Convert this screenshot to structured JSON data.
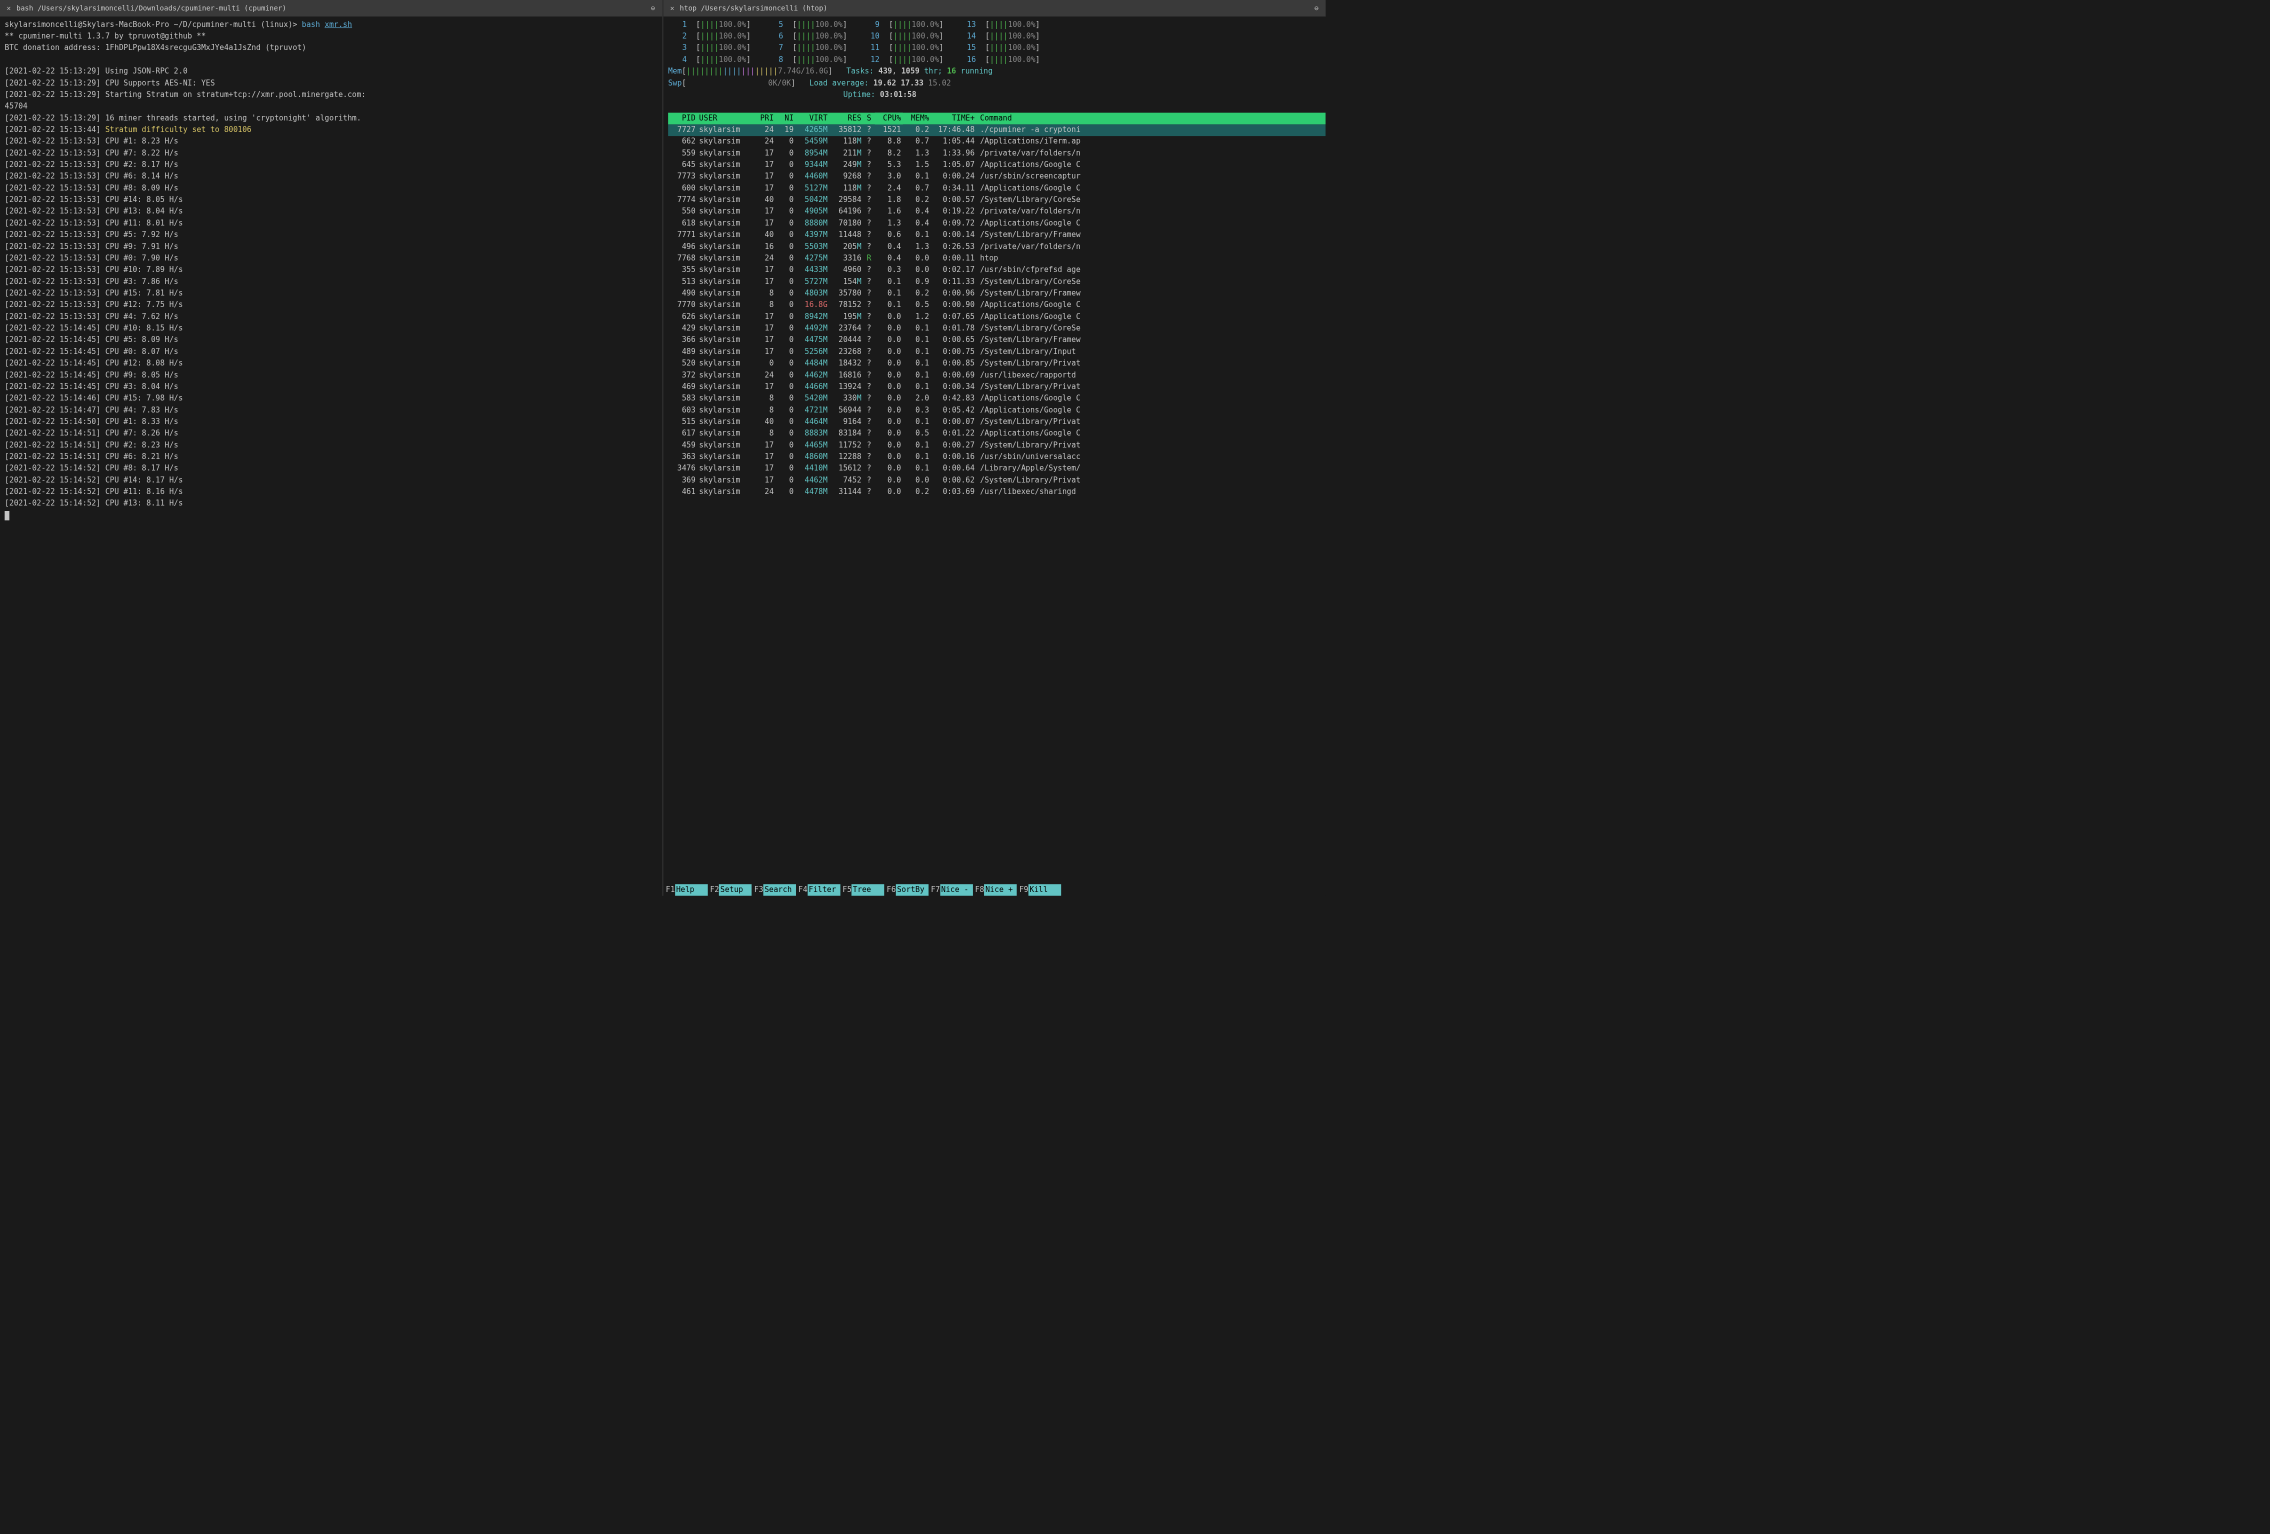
{
  "tabs": {
    "left": "bash /Users/skylarsimoncelli/Downloads/cpuminer-multi (cpuminer)",
    "right": "htop /Users/skylarsimoncelli (htop)"
  },
  "prompt": {
    "userhost": "skylarsimoncelli@Skylars-MacBook-Pro",
    "path": "~/D/cpuminer-multi",
    "os": "(linux)",
    "arrow": ">",
    "cmd": "bash",
    "arg": "xmr.sh"
  },
  "banner": [
    "** cpuminer-multi 1.3.7 by tpruvot@github **",
    "BTC donation address: 1FhDPLPpw18X4srecguG3MxJYe4a1JsZnd (tpruvot)"
  ],
  "log": [
    {
      "t": "[2021-02-22 15:13:29]",
      "m": "Using JSON-RPC 2.0"
    },
    {
      "t": "[2021-02-22 15:13:29]",
      "m": "CPU Supports AES-NI: YES"
    },
    {
      "t": "[2021-02-22 15:13:29]",
      "m": "Starting Stratum on stratum+tcp://xmr.pool.minergate.com:"
    },
    {
      "t": "",
      "m": "45704"
    },
    {
      "t": "[2021-02-22 15:13:29]",
      "m": "16 miner threads started, using 'cryptonight' algorithm."
    },
    {
      "t": "[2021-02-22 15:13:44]",
      "m": "Stratum difficulty set to 800106",
      "y": true
    },
    {
      "t": "[2021-02-22 15:13:53]",
      "m": "CPU #1: 8.23 H/s"
    },
    {
      "t": "[2021-02-22 15:13:53]",
      "m": "CPU #7: 8.22 H/s"
    },
    {
      "t": "[2021-02-22 15:13:53]",
      "m": "CPU #2: 8.17 H/s"
    },
    {
      "t": "[2021-02-22 15:13:53]",
      "m": "CPU #6: 8.14 H/s"
    },
    {
      "t": "[2021-02-22 15:13:53]",
      "m": "CPU #8: 8.09 H/s"
    },
    {
      "t": "[2021-02-22 15:13:53]",
      "m": "CPU #14: 8.05 H/s"
    },
    {
      "t": "[2021-02-22 15:13:53]",
      "m": "CPU #13: 8.04 H/s"
    },
    {
      "t": "[2021-02-22 15:13:53]",
      "m": "CPU #11: 8.01 H/s"
    },
    {
      "t": "[2021-02-22 15:13:53]",
      "m": "CPU #5: 7.92 H/s"
    },
    {
      "t": "[2021-02-22 15:13:53]",
      "m": "CPU #9: 7.91 H/s"
    },
    {
      "t": "[2021-02-22 15:13:53]",
      "m": "CPU #0: 7.90 H/s"
    },
    {
      "t": "[2021-02-22 15:13:53]",
      "m": "CPU #10: 7.89 H/s"
    },
    {
      "t": "[2021-02-22 15:13:53]",
      "m": "CPU #3: 7.86 H/s"
    },
    {
      "t": "[2021-02-22 15:13:53]",
      "m": "CPU #15: 7.81 H/s"
    },
    {
      "t": "[2021-02-22 15:13:53]",
      "m": "CPU #12: 7.75 H/s"
    },
    {
      "t": "[2021-02-22 15:13:53]",
      "m": "CPU #4: 7.62 H/s"
    },
    {
      "t": "[2021-02-22 15:14:45]",
      "m": "CPU #10: 8.15 H/s"
    },
    {
      "t": "[2021-02-22 15:14:45]",
      "m": "CPU #5: 8.09 H/s"
    },
    {
      "t": "[2021-02-22 15:14:45]",
      "m": "CPU #0: 8.07 H/s"
    },
    {
      "t": "[2021-02-22 15:14:45]",
      "m": "CPU #12: 8.08 H/s"
    },
    {
      "t": "[2021-02-22 15:14:45]",
      "m": "CPU #9: 8.05 H/s"
    },
    {
      "t": "[2021-02-22 15:14:45]",
      "m": "CPU #3: 8.04 H/s"
    },
    {
      "t": "[2021-02-22 15:14:46]",
      "m": "CPU #15: 7.98 H/s"
    },
    {
      "t": "[2021-02-22 15:14:47]",
      "m": "CPU #4: 7.83 H/s"
    },
    {
      "t": "[2021-02-22 15:14:50]",
      "m": "CPU #1: 8.33 H/s"
    },
    {
      "t": "[2021-02-22 15:14:51]",
      "m": "CPU #7: 8.26 H/s"
    },
    {
      "t": "[2021-02-22 15:14:51]",
      "m": "CPU #2: 8.23 H/s"
    },
    {
      "t": "[2021-02-22 15:14:51]",
      "m": "CPU #6: 8.21 H/s"
    },
    {
      "t": "[2021-02-22 15:14:52]",
      "m": "CPU #8: 8.17 H/s"
    },
    {
      "t": "[2021-02-22 15:14:52]",
      "m": "CPU #14: 8.17 H/s"
    },
    {
      "t": "[2021-02-22 15:14:52]",
      "m": "CPU #11: 8.16 H/s"
    },
    {
      "t": "[2021-02-22 15:14:52]",
      "m": "CPU #13: 8.11 H/s"
    }
  ],
  "htop": {
    "cpus": [
      {
        "n": "1",
        "p": "100.0%"
      },
      {
        "n": "2",
        "p": "100.0%"
      },
      {
        "n": "3",
        "p": "100.0%"
      },
      {
        "n": "4",
        "p": "100.0%"
      },
      {
        "n": "5",
        "p": "100.0%"
      },
      {
        "n": "6",
        "p": "100.0%"
      },
      {
        "n": "7",
        "p": "100.0%"
      },
      {
        "n": "8",
        "p": "100.0%"
      },
      {
        "n": "9",
        "p": "100.0%"
      },
      {
        "n": "10",
        "p": "100.0%"
      },
      {
        "n": "11",
        "p": "100.0%"
      },
      {
        "n": "12",
        "p": "100.0%"
      },
      {
        "n": "13",
        "p": "100.0%"
      },
      {
        "n": "14",
        "p": "100.0%"
      },
      {
        "n": "15",
        "p": "100.0%"
      },
      {
        "n": "16",
        "p": "100.0%"
      }
    ],
    "mem": {
      "label": "Mem",
      "bar": "||||||||||||||||||||",
      "used": "7.74G",
      "total": "16.0G"
    },
    "swp": {
      "label": "Swp",
      "used": "0K",
      "total": "0K"
    },
    "tasks": {
      "label": "Tasks:",
      "count": "439",
      "thr": "1059",
      "thr_lab": "thr;",
      "run": "16",
      "run_lab": "running"
    },
    "load": {
      "label": "Load average:",
      "v1": "19.62",
      "v2": "17.33",
      "v3": "15.02"
    },
    "uptime": {
      "label": "Uptime:",
      "val": "03:01:58"
    },
    "cols": {
      "pid": "PID",
      "user": "USER",
      "pri": "PRI",
      "ni": "NI",
      "virt": "VIRT",
      "res": "RES",
      "s": "S",
      "cpu": "CPU%",
      "mem": "MEM%",
      "time": "TIME+",
      "cmd": "Command"
    },
    "rows": [
      {
        "pid": "7727",
        "user": "skylarsim",
        "pri": "24",
        "ni": "19",
        "virt": "4265M",
        "res": "35812",
        "s": "?",
        "cpu": "1521",
        "mem": "0.2",
        "time": "17:46.48",
        "cmd": "./cpuminer -a cryptoni",
        "sel": true
      },
      {
        "pid": "662",
        "user": "skylarsim",
        "pri": "24",
        "ni": "0",
        "virt": "5459M",
        "res": "118M",
        "s": "?",
        "cpu": "8.8",
        "mem": "0.7",
        "time": "1:05.44",
        "cmd": "/Applications/iTerm.ap"
      },
      {
        "pid": "559",
        "user": "skylarsim",
        "pri": "17",
        "ni": "0",
        "virt": "8954M",
        "res": "211M",
        "s": "?",
        "cpu": "8.2",
        "mem": "1.3",
        "time": "1:33.96",
        "cmd": "/private/var/folders/n"
      },
      {
        "pid": "645",
        "user": "skylarsim",
        "pri": "17",
        "ni": "0",
        "virt": "9344M",
        "res": "249M",
        "s": "?",
        "cpu": "5.3",
        "mem": "1.5",
        "time": "1:05.07",
        "cmd": "/Applications/Google C"
      },
      {
        "pid": "7773",
        "user": "skylarsim",
        "pri": "17",
        "ni": "0",
        "virt": "4460M",
        "res": "9268",
        "s": "?",
        "cpu": "3.0",
        "mem": "0.1",
        "time": "0:00.24",
        "cmd": "/usr/sbin/screencaptur"
      },
      {
        "pid": "600",
        "user": "skylarsim",
        "pri": "17",
        "ni": "0",
        "virt": "5127M",
        "res": "118M",
        "s": "?",
        "cpu": "2.4",
        "mem": "0.7",
        "time": "0:34.11",
        "cmd": "/Applications/Google C"
      },
      {
        "pid": "7774",
        "user": "skylarsim",
        "pri": "40",
        "ni": "0",
        "virt": "5042M",
        "res": "29584",
        "s": "?",
        "cpu": "1.8",
        "mem": "0.2",
        "time": "0:00.57",
        "cmd": "/System/Library/CoreSe"
      },
      {
        "pid": "550",
        "user": "skylarsim",
        "pri": "17",
        "ni": "0",
        "virt": "4905M",
        "res": "64196",
        "s": "?",
        "cpu": "1.6",
        "mem": "0.4",
        "time": "0:19.22",
        "cmd": "/private/var/folders/n"
      },
      {
        "pid": "618",
        "user": "skylarsim",
        "pri": "17",
        "ni": "0",
        "virt": "8880M",
        "res": "70180",
        "s": "?",
        "cpu": "1.3",
        "mem": "0.4",
        "time": "0:09.72",
        "cmd": "/Applications/Google C"
      },
      {
        "pid": "7771",
        "user": "skylarsim",
        "pri": "40",
        "ni": "0",
        "virt": "4397M",
        "res": "11448",
        "s": "?",
        "cpu": "0.6",
        "mem": "0.1",
        "time": "0:00.14",
        "cmd": "/System/Library/Framew"
      },
      {
        "pid": "496",
        "user": "skylarsim",
        "pri": "16",
        "ni": "0",
        "virt": "5503M",
        "res": "205M",
        "s": "?",
        "cpu": "0.4",
        "mem": "1.3",
        "time": "0:26.53",
        "cmd": "/private/var/folders/n"
      },
      {
        "pid": "7768",
        "user": "skylarsim",
        "pri": "24",
        "ni": "0",
        "virt": "4275M",
        "res": "3316",
        "s": "R",
        "cpu": "0.4",
        "mem": "0.0",
        "time": "0:00.11",
        "cmd": "htop",
        "sR": true
      },
      {
        "pid": "355",
        "user": "skylarsim",
        "pri": "17",
        "ni": "0",
        "virt": "4433M",
        "res": "4960",
        "s": "?",
        "cpu": "0.3",
        "mem": "0.0",
        "time": "0:02.17",
        "cmd": "/usr/sbin/cfprefsd age"
      },
      {
        "pid": "513",
        "user": "skylarsim",
        "pri": "17",
        "ni": "0",
        "virt": "5727M",
        "res": "154M",
        "s": "?",
        "cpu": "0.1",
        "mem": "0.9",
        "time": "0:11.33",
        "cmd": "/System/Library/CoreSe"
      },
      {
        "pid": "490",
        "user": "skylarsim",
        "pri": "8",
        "ni": "0",
        "virt": "4803M",
        "res": "35780",
        "s": "?",
        "cpu": "0.1",
        "mem": "0.2",
        "time": "0:00.96",
        "cmd": "/System/Library/Framew"
      },
      {
        "pid": "7770",
        "user": "skylarsim",
        "pri": "8",
        "ni": "0",
        "virt": "16.8G",
        "res": "78152",
        "s": "?",
        "cpu": "0.1",
        "mem": "0.5",
        "time": "0:00.90",
        "cmd": "/Applications/Google C",
        "vR": true
      },
      {
        "pid": "626",
        "user": "skylarsim",
        "pri": "17",
        "ni": "0",
        "virt": "8942M",
        "res": "195M",
        "s": "?",
        "cpu": "0.0",
        "mem": "1.2",
        "time": "0:07.65",
        "cmd": "/Applications/Google C"
      },
      {
        "pid": "429",
        "user": "skylarsim",
        "pri": "17",
        "ni": "0",
        "virt": "4492M",
        "res": "23764",
        "s": "?",
        "cpu": "0.0",
        "mem": "0.1",
        "time": "0:01.78",
        "cmd": "/System/Library/CoreSe"
      },
      {
        "pid": "366",
        "user": "skylarsim",
        "pri": "17",
        "ni": "0",
        "virt": "4475M",
        "res": "20444",
        "s": "?",
        "cpu": "0.0",
        "mem": "0.1",
        "time": "0:00.65",
        "cmd": "/System/Library/Framew"
      },
      {
        "pid": "489",
        "user": "skylarsim",
        "pri": "17",
        "ni": "0",
        "virt": "5256M",
        "res": "23268",
        "s": "?",
        "cpu": "0.0",
        "mem": "0.1",
        "time": "0:00.75",
        "cmd": "/System/Library/Input"
      },
      {
        "pid": "520",
        "user": "skylarsim",
        "pri": "0",
        "ni": "0",
        "virt": "4484M",
        "res": "18432",
        "s": "?",
        "cpu": "0.0",
        "mem": "0.1",
        "time": "0:00.85",
        "cmd": "/System/Library/Privat"
      },
      {
        "pid": "372",
        "user": "skylarsim",
        "pri": "24",
        "ni": "0",
        "virt": "4462M",
        "res": "16816",
        "s": "?",
        "cpu": "0.0",
        "mem": "0.1",
        "time": "0:00.69",
        "cmd": "/usr/libexec/rapportd"
      },
      {
        "pid": "469",
        "user": "skylarsim",
        "pri": "17",
        "ni": "0",
        "virt": "4466M",
        "res": "13924",
        "s": "?",
        "cpu": "0.0",
        "mem": "0.1",
        "time": "0:00.34",
        "cmd": "/System/Library/Privat"
      },
      {
        "pid": "583",
        "user": "skylarsim",
        "pri": "8",
        "ni": "0",
        "virt": "5420M",
        "res": "330M",
        "s": "?",
        "cpu": "0.0",
        "mem": "2.0",
        "time": "0:42.83",
        "cmd": "/Applications/Google C"
      },
      {
        "pid": "603",
        "user": "skylarsim",
        "pri": "8",
        "ni": "0",
        "virt": "4721M",
        "res": "56944",
        "s": "?",
        "cpu": "0.0",
        "mem": "0.3",
        "time": "0:05.42",
        "cmd": "/Applications/Google C"
      },
      {
        "pid": "515",
        "user": "skylarsim",
        "pri": "40",
        "ni": "0",
        "virt": "4464M",
        "res": "9164",
        "s": "?",
        "cpu": "0.0",
        "mem": "0.1",
        "time": "0:00.07",
        "cmd": "/System/Library/Privat"
      },
      {
        "pid": "617",
        "user": "skylarsim",
        "pri": "8",
        "ni": "0",
        "virt": "8883M",
        "res": "83184",
        "s": "?",
        "cpu": "0.0",
        "mem": "0.5",
        "time": "0:01.22",
        "cmd": "/Applications/Google C"
      },
      {
        "pid": "459",
        "user": "skylarsim",
        "pri": "17",
        "ni": "0",
        "virt": "4465M",
        "res": "11752",
        "s": "?",
        "cpu": "0.0",
        "mem": "0.1",
        "time": "0:00.27",
        "cmd": "/System/Library/Privat"
      },
      {
        "pid": "363",
        "user": "skylarsim",
        "pri": "17",
        "ni": "0",
        "virt": "4860M",
        "res": "12288",
        "s": "?",
        "cpu": "0.0",
        "mem": "0.1",
        "time": "0:00.16",
        "cmd": "/usr/sbin/universalacc"
      },
      {
        "pid": "3476",
        "user": "skylarsim",
        "pri": "17",
        "ni": "0",
        "virt": "4410M",
        "res": "15612",
        "s": "?",
        "cpu": "0.0",
        "mem": "0.1",
        "time": "0:00.64",
        "cmd": "/Library/Apple/System/"
      },
      {
        "pid": "369",
        "user": "skylarsim",
        "pri": "17",
        "ni": "0",
        "virt": "4462M",
        "res": "7452",
        "s": "?",
        "cpu": "0.0",
        "mem": "0.0",
        "time": "0:00.62",
        "cmd": "/System/Library/Privat"
      },
      {
        "pid": "461",
        "user": "skylarsim",
        "pri": "24",
        "ni": "0",
        "virt": "4478M",
        "res": "31144",
        "s": "?",
        "cpu": "0.0",
        "mem": "0.2",
        "time": "0:03.69",
        "cmd": "/usr/libexec/sharingd"
      }
    ],
    "fkeys": [
      {
        "k": "F1",
        "l": "Help"
      },
      {
        "k": "F2",
        "l": "Setup"
      },
      {
        "k": "F3",
        "l": "Search"
      },
      {
        "k": "F4",
        "l": "Filter"
      },
      {
        "k": "F5",
        "l": "Tree"
      },
      {
        "k": "F6",
        "l": "SortBy"
      },
      {
        "k": "F7",
        "l": "Nice -"
      },
      {
        "k": "F8",
        "l": "Nice +"
      },
      {
        "k": "F9",
        "l": "Kill"
      }
    ]
  }
}
